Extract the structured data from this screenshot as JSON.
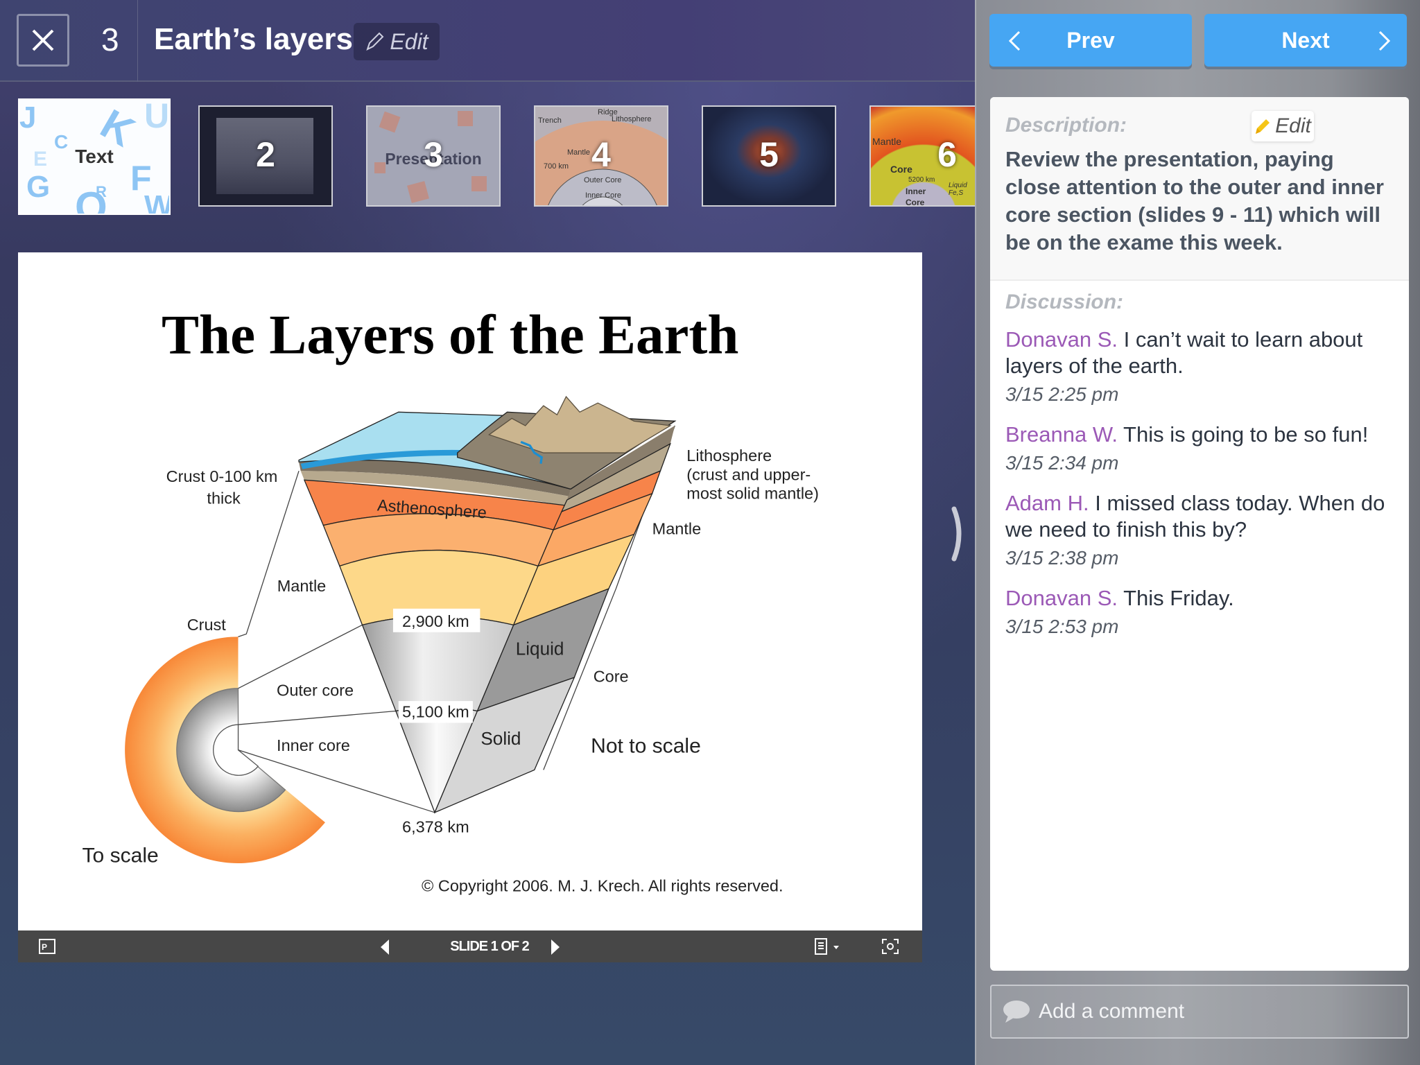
{
  "header": {
    "close_icon": "close-icon",
    "item_number": "3",
    "title": "Earth’s layers",
    "edit_label": "Edit"
  },
  "thumbnails": [
    {
      "label": "Text"
    },
    {
      "label": "2"
    },
    {
      "label": "3",
      "image_text": "Presentation"
    },
    {
      "label": "4",
      "image_text": [
        "Trench",
        "Ridge",
        "Lithosphere",
        "Mantle",
        "700 km",
        "Outer Core",
        "Inner Core"
      ]
    },
    {
      "label": "5"
    },
    {
      "label": "6",
      "image_text": [
        "Mantle",
        "Core",
        "5200 km",
        "Inner Core",
        "Liquid Fe,S"
      ]
    }
  ],
  "slide": {
    "title": "The Layers of the Earth",
    "labels": {
      "crust_thick": "Crust 0-100 km",
      "thick": "thick",
      "mantle_left": "Mantle",
      "crust": "Crust",
      "outer_core": "Outer core",
      "inner_core": "Inner core",
      "to_scale": "To scale",
      "km2900": "2,900 km",
      "km5100": "5,100 km",
      "km6378": "6,378 km",
      "liquid": "Liquid",
      "solid": "Solid",
      "asthenosphere": "Asthenosphere",
      "lithosphere": "Lithosphere",
      "litho2": "(crust and upper-",
      "litho3": "most solid mantle)",
      "mantle_right": "Mantle",
      "core": "Core",
      "not_to_scale": "Not to scale",
      "copyright": "© Copyright 2006.  M. J. Krech. All rights reserved."
    }
  },
  "toolbar": {
    "slide_counter": "SLIDE 1 OF 2"
  },
  "nav": {
    "prev_label": "Prev",
    "next_label": "Next",
    "color": "#46a6f3"
  },
  "description": {
    "label": "Description:",
    "edit_label": "Edit",
    "text": "Review the presentation, paying close attention to the outer and inner core section (slides 9 - 11) which will be on the exame this week."
  },
  "discussion": {
    "label": "Discussion:",
    "name_color": "#9b59b6",
    "comments": [
      {
        "author": "Donavan S.",
        "text": "I can’t wait to learn about layers of the earth.",
        "time": "3/15 2:25 pm"
      },
      {
        "author": "Breanna W.",
        "text": "This is going to be so fun!",
        "time": "3/15 2:34 pm"
      },
      {
        "author": "Adam H.",
        "text": "I missed class today. When do we need to finish this by?",
        "time": "3/15 2:38 pm"
      },
      {
        "author": "Donavan S.",
        "text": "This Friday.",
        "time": "3/15 2:53 pm"
      }
    ]
  },
  "comment_input": {
    "placeholder": "Add a comment"
  }
}
